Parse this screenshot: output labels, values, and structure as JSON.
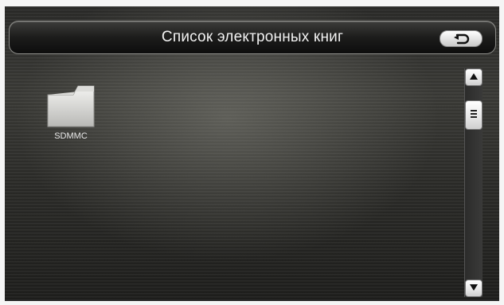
{
  "header": {
    "title": "Список электронных книг",
    "back_icon": "back-arrow-icon"
  },
  "files": [
    {
      "label": "SDMMC",
      "icon": "folder-icon"
    }
  ],
  "scrollbar": {
    "up_icon": "triangle-up-icon",
    "thumb_icon": "grip-icon",
    "down_icon": "triangle-down-icon"
  },
  "colors": {
    "title_text": "#f2f2f2",
    "button_face": "#ffffff",
    "background": "#2e2e2b"
  }
}
